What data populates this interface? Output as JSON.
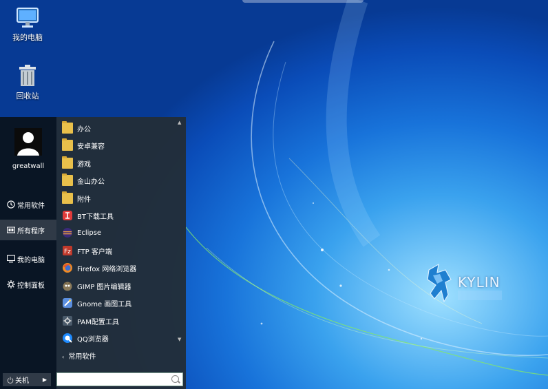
{
  "desktop": {
    "icons": [
      {
        "label": "我的电脑",
        "icon": "monitor-icon"
      },
      {
        "label": "回收站",
        "icon": "trash-icon"
      }
    ],
    "brand": {
      "text": "KYLIN",
      "icon": "kylin-logo"
    }
  },
  "start_menu": {
    "user": {
      "name": "greatwall",
      "icon": "avatar-icon"
    },
    "left_items": [
      {
        "label": "常用软件",
        "icon": "clock-icon"
      },
      {
        "label": "所有程序",
        "icon": "apps-icon"
      },
      {
        "label": "我的电脑",
        "icon": "computer-icon"
      },
      {
        "label": "控制面板",
        "icon": "gear-icon"
      }
    ],
    "shutdown": {
      "label": "关机",
      "icon": "power-icon"
    },
    "programs": [
      {
        "label": "办公",
        "icon": "folder-icon"
      },
      {
        "label": "安卓兼容",
        "icon": "folder-icon"
      },
      {
        "label": "游戏",
        "icon": "folder-icon"
      },
      {
        "label": "金山办公",
        "icon": "folder-icon"
      },
      {
        "label": "附件",
        "icon": "folder-icon"
      },
      {
        "label": "BT下载工具",
        "icon": "bt-icon"
      },
      {
        "label": "Eclipse",
        "icon": "eclipse-icon"
      },
      {
        "label": "FTP 客户端",
        "icon": "filezilla-icon"
      },
      {
        "label": "Firefox 网络浏览器",
        "icon": "firefox-icon"
      },
      {
        "label": "GIMP 图片编辑器",
        "icon": "gimp-icon"
      },
      {
        "label": "Gnome 画图工具",
        "icon": "paint-icon"
      },
      {
        "label": "PAM配置工具",
        "icon": "pam-icon"
      },
      {
        "label": "QQ浏览器",
        "icon": "qq-browser-icon"
      }
    ],
    "back_label": "常用软件",
    "search": {
      "placeholder": "",
      "value": ""
    }
  }
}
